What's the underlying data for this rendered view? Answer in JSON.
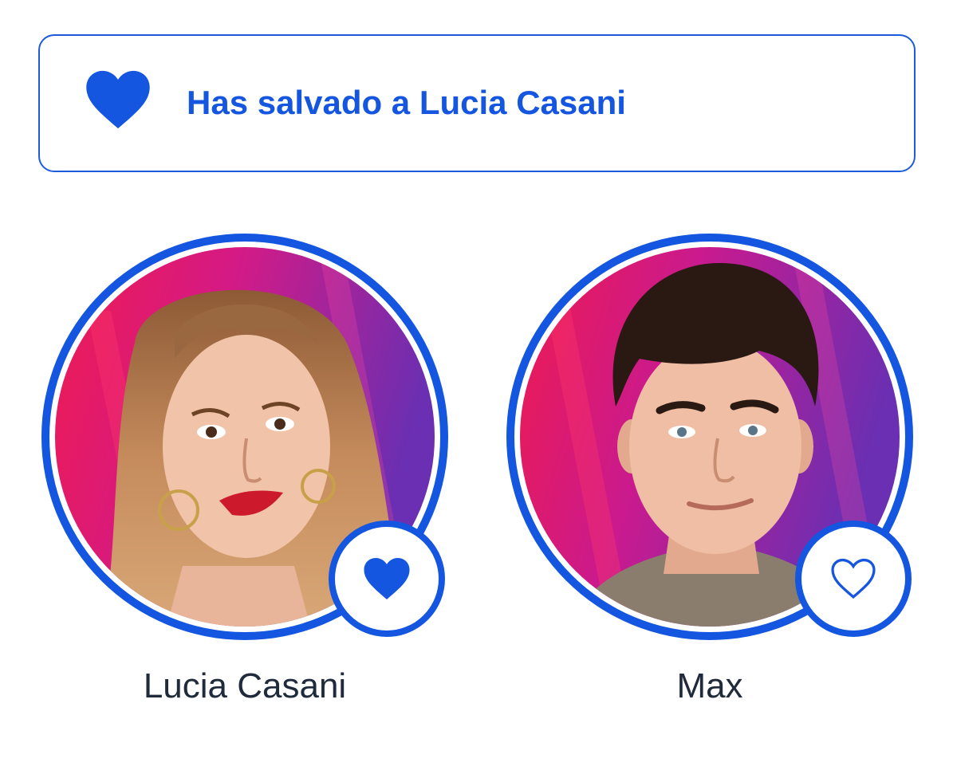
{
  "banner": {
    "message": "Has salvado a Lucia Casani",
    "icon": "heart-filled-icon",
    "accent_color": "#1456e0"
  },
  "candidates": [
    {
      "name": "Lucia Casani",
      "saved": true,
      "vote_icon": "heart-filled-icon"
    },
    {
      "name": "Max",
      "saved": false,
      "vote_icon": "heart-outline-icon"
    }
  ],
  "colors": {
    "accent": "#1456e0",
    "text": "#1f2a3a",
    "photo_background_start": "#e8195a",
    "photo_background_end": "#7a2fb0"
  }
}
